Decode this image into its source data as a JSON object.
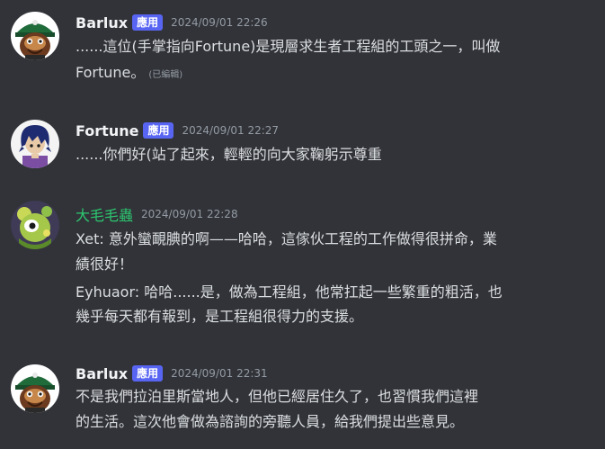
{
  "colors": {
    "background": "#313338",
    "text": "#dbdee1",
    "username": "#f2f3f5",
    "username_green": "#2dc770",
    "badge": "#5865f2",
    "timestamp": "#949ba4"
  },
  "messages": [
    {
      "avatar_icon": "dwarf-green-hat-avatar-icon",
      "username": "Barlux",
      "badge": "應用",
      "timestamp": "2024/09/01 22:26",
      "lines": [
        "......這位(手掌指向Fortune)是現層求生者工程組的工頭之一，叫做",
        "Fortune。"
      ],
      "edited": "(已編輯)"
    },
    {
      "avatar_icon": "blue-hair-purple-shirt-avatar-icon",
      "username": "Fortune",
      "badge": "應用",
      "timestamp": "2024/09/01 22:27",
      "lines": [
        "......你們好(站了起來，輕輕的向大家鞠躬示尊重"
      ]
    },
    {
      "avatar_icon": "green-creature-avatar-icon",
      "username": "大毛毛蟲",
      "timestamp": "2024/09/01 22:28",
      "lines": [
        "Xet: 意外蠻靦腆的啊——哈哈，這傢伙工程的工作做得很拼命，業",
        "績很好！",
        "Eyhuaor: 哈哈......是，做為工程組，他常扛起一些繁重的粗活，也",
        "幾乎每天都有報到，是工程組很得力的支援。"
      ]
    },
    {
      "avatar_icon": "dwarf-green-hat-avatar-icon",
      "username": "Barlux",
      "badge": "應用",
      "timestamp": "2024/09/01 22:31",
      "lines": [
        "不是我們拉泊里斯當地人，但他已經居住久了，也習慣我們這裡",
        "的生活。這次他會做為諮詢的旁聽人員，給我們提出些意見。"
      ]
    }
  ]
}
